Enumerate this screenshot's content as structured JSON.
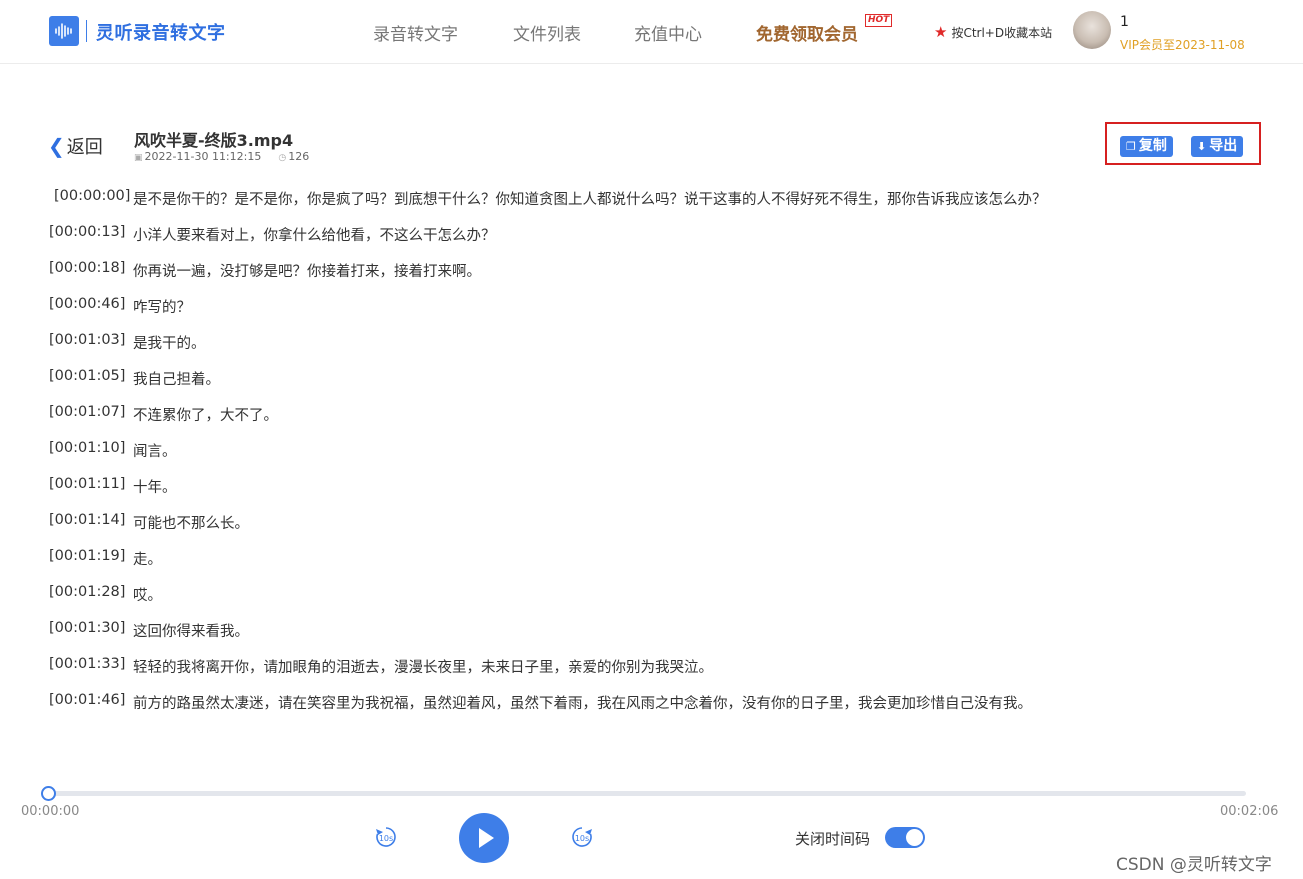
{
  "header": {
    "brand": "灵听录音转文字",
    "nav": [
      "录音转文字",
      "文件列表",
      "充值中心"
    ],
    "free_vip": "免费领取会员",
    "hot_badge": "HOT",
    "bookmark_hint": "按Ctrl+D收藏本站",
    "username": "1",
    "vip_expiry": "VIP会员至2023-11-08"
  },
  "file": {
    "back_label": "返回",
    "name": "风吹半夏-终版3.mp4",
    "created": "2022-11-30 11:12:15",
    "views": "126",
    "copy_label": "复制",
    "export_label": "导出"
  },
  "transcript": [
    {
      "ts": "[00:00:00]",
      "text": "是不是你干的？是不是你，你是疯了吗？到底想干什么？你知道贪图上人都说什么吗？说干这事的人不得好死不得生，那你告诉我应该怎么办？"
    },
    {
      "ts": "[00:00:13]",
      "text": "小洋人要来看对上，你拿什么给他看，不这么干怎么办？"
    },
    {
      "ts": "[00:00:18]",
      "text": "你再说一遍，没打够是吧？你接着打来，接着打来啊。"
    },
    {
      "ts": "[00:00:46]",
      "text": "咋写的？"
    },
    {
      "ts": "[00:01:03]",
      "text": "是我干的。"
    },
    {
      "ts": "[00:01:05]",
      "text": "我自己担着。"
    },
    {
      "ts": "[00:01:07]",
      "text": "不连累你了，大不了。"
    },
    {
      "ts": "[00:01:10]",
      "text": "闻言。"
    },
    {
      "ts": "[00:01:11]",
      "text": "十年。"
    },
    {
      "ts": "[00:01:14]",
      "text": "可能也不那么长。"
    },
    {
      "ts": "[00:01:19]",
      "text": "走。"
    },
    {
      "ts": "[00:01:28]",
      "text": "哎。"
    },
    {
      "ts": "[00:01:30]",
      "text": "这回你得来看我。"
    },
    {
      "ts": "[00:01:33]",
      "text": "轻轻的我将离开你，请加眼角的泪逝去，漫漫长夜里，未来日子里，亲爱的你别为我哭泣。"
    },
    {
      "ts": "[00:01:46]",
      "text": "前方的路虽然太凄迷，请在笑容里为我祝福，虽然迎着风，虽然下着雨，我在风雨之中念着你，没有你的日子里，我会更加珍惜自己没有我。"
    }
  ],
  "player": {
    "current_time": "00:00:00",
    "total_time": "00:02:06",
    "progress": 0,
    "skip_back": "10s",
    "skip_forward": "10s",
    "timecode_label": "关闭时间码",
    "timecode_on": true
  },
  "watermark": "CSDN @灵听转文字",
  "colors": {
    "accent": "#3e7ee8",
    "highlight_box": "#d62020",
    "vip": "#e0a025",
    "free_vip": "#a1662f"
  }
}
